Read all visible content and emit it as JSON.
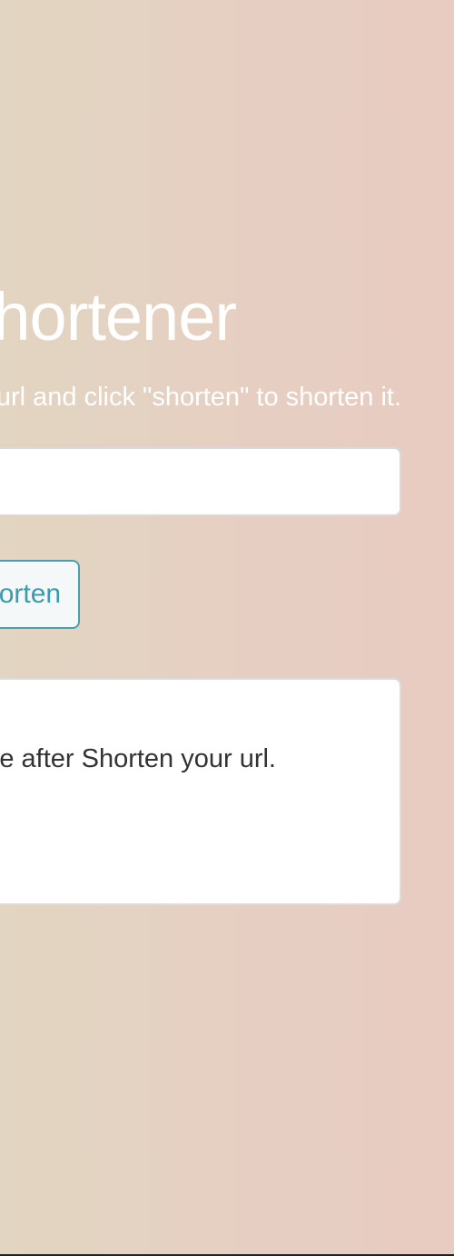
{
  "header": {
    "title": "URL Shortener",
    "subtitle": "Enter a url and click \"shorten\" to shorten it."
  },
  "form": {
    "url_input": {
      "value": "",
      "placeholder": ""
    },
    "shorten_label": "Shorten"
  },
  "result": {
    "message": "Your result will appear here after Shorten your url."
  },
  "colors": {
    "background_left": "#e2d5c1",
    "background_right": "#e8cbc1",
    "accent": "#4a9eb0",
    "text": "#333333"
  }
}
